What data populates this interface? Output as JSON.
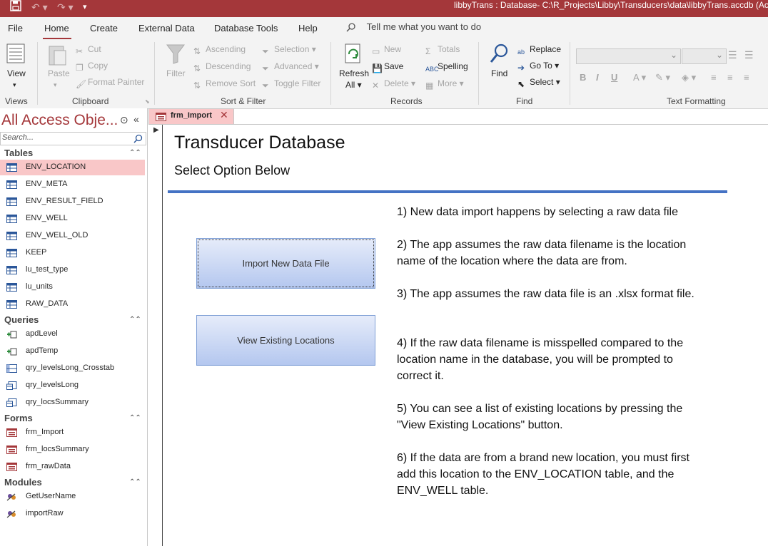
{
  "titlebar": {
    "title": "libbyTrans : Database- C:\\R_Projects\\Libby\\Transducers\\data\\libbyTrans.accdb (Acc"
  },
  "ribbon_tabs": [
    "File",
    "Home",
    "Create",
    "External Data",
    "Database Tools",
    "Help"
  ],
  "tell_me": "Tell me what you want to do",
  "groups": {
    "views": {
      "label": "Views",
      "view": "View"
    },
    "clipboard": {
      "label": "Clipboard",
      "paste": "Paste",
      "cut": "Cut",
      "copy": "Copy",
      "format_painter": "Format Painter"
    },
    "sort_filter": {
      "label": "Sort & Filter",
      "filter": "Filter",
      "ascending": "Ascending",
      "descending": "Descending",
      "remove_sort": "Remove Sort",
      "selection": "Selection",
      "advanced": "Advanced",
      "toggle_filter": "Toggle Filter"
    },
    "records": {
      "label": "Records",
      "refresh": "Refresh",
      "refresh_all": "All",
      "new": "New",
      "save": "Save",
      "delete": "Delete",
      "totals": "Totals",
      "spelling": "Spelling",
      "more": "More"
    },
    "find": {
      "label": "Find",
      "find": "Find",
      "replace": "Replace",
      "go_to": "Go To",
      "select": "Select"
    },
    "text_formatting": {
      "label": "Text Formatting"
    }
  },
  "nav": {
    "title": "All Access Obje...",
    "search_placeholder": "Search...",
    "sections": [
      {
        "name": "Tables",
        "items": [
          "ENV_LOCATION",
          "ENV_META",
          "ENV_RESULT_FIELD",
          "ENV_WELL",
          "ENV_WELL_OLD",
          "KEEP",
          "lu_test_type",
          "lu_units",
          "RAW_DATA"
        ]
      },
      {
        "name": "Queries",
        "items": [
          "apdLevel",
          "apdTemp",
          "qry_levelsLong_Crosstab",
          "qry_levelsLong",
          "qry_locsSummary"
        ]
      },
      {
        "name": "Forms",
        "items": [
          "frm_Import",
          "frm_locsSummary",
          "frm_rawData"
        ]
      },
      {
        "name": "Modules",
        "items": [
          "GetUserName",
          "importRaw"
        ]
      }
    ],
    "selected": "ENV_LOCATION"
  },
  "doc_tab": {
    "label": "frm_Import"
  },
  "form": {
    "title": "Transducer Database",
    "subtitle": "Select Option Below",
    "import_button": "Import New Data File",
    "view_button": "View Existing Locations",
    "instructions": [
      "1) New data import happens by selecting a raw data file",
      "2) The app assumes the raw data filename is the location name of the location where the data are from.",
      "3) The app assumes the raw data file is an .xlsx format file.",
      "4) If the raw data filename is misspelled compared to the location name in the database, you will be prompted to correct it.",
      "5) You can see a list of existing locations by pressing the \"View Existing Locations\" button.",
      "6) If the data are from a brand new location, you must first add this location to the ENV_LOCATION table, and the ENV_WELL table."
    ]
  },
  "colors": {
    "accent": "#a4373a",
    "selected_bg": "#f9c7c8",
    "rule": "#4472c4"
  }
}
